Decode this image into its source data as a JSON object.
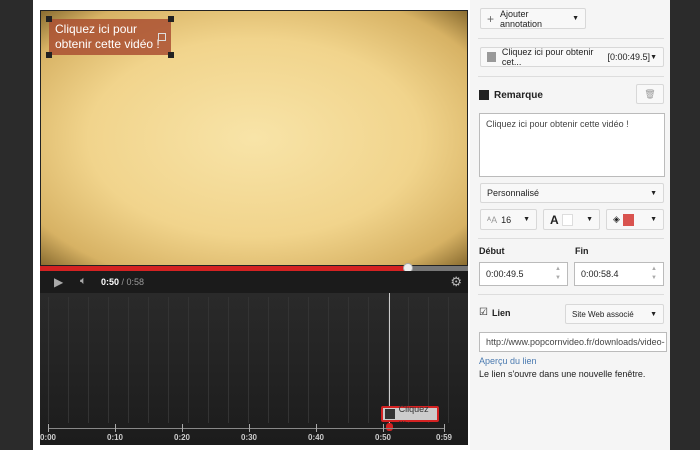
{
  "video": {
    "annotation_text": "Cliquez ici pour obtenir cette vidéo !",
    "progress_percent": 86,
    "current_time": "0:50",
    "duration": "0:58",
    "progress_color": "#d42222"
  },
  "timeline": {
    "ticks": [
      "0:00",
      "0:10",
      "0:20",
      "0:30",
      "0:40",
      "0:50",
      "0:59"
    ],
    "annotation_label": "Cliquez ..."
  },
  "panel": {
    "add_annotation": "Ajouter annotation",
    "selected_annotation": "Cliquez ici pour obtenir cet...",
    "selected_time": "[0:00:49.5]",
    "type_label": "Remarque",
    "text_value": "Cliquez ici pour obtenir cette vidéo !",
    "style_select": "Personnalisé",
    "font_size": "16",
    "text_color": "#ffffff",
    "bg_color": "#d9534f",
    "start_label": "Début",
    "start_value": "0:00:49.5",
    "end_label": "Fin",
    "end_value": "0:00:58.4",
    "link_label": "Lien",
    "link_checked": true,
    "link_type": "Site Web associé",
    "link_url": "http://www.popcornvideo.fr/downloads/video-",
    "preview_link": "Aperçu du lien",
    "link_note": "Le lien s'ouvre dans une nouvelle fenêtre."
  }
}
